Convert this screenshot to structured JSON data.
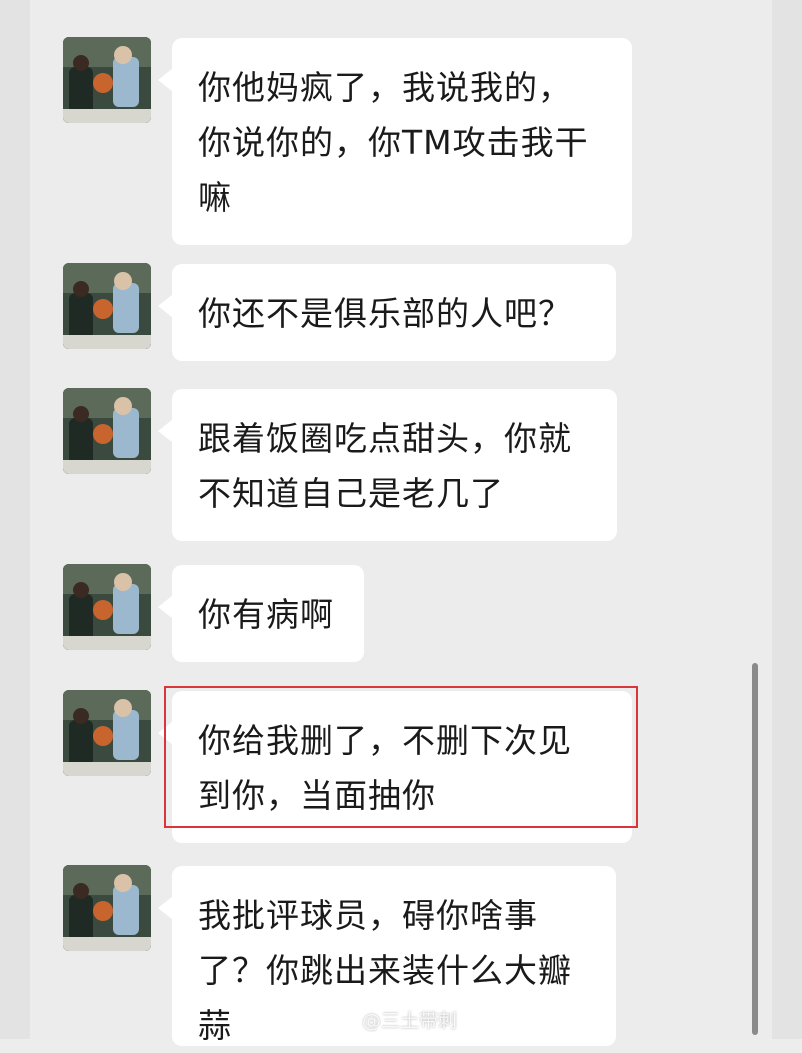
{
  "messages": [
    {
      "text": "你他妈疯了，我说我的，\n你说你的，你TM攻击我干\n嘛"
    },
    {
      "text": "你还不是俱乐部的人吧？"
    },
    {
      "text": "跟着饭圈吃点甜头，你就\n不知道自己是老几了"
    },
    {
      "text": "你有病啊"
    },
    {
      "text": "你给我删了，不删下次见\n到你，当面抽你"
    },
    {
      "text": "我批评球员，碍你啥事\n了？你跳出来装什么大瓣\n蒜"
    }
  ],
  "watermark": {
    "text": "@三土带刺",
    "icon": "weibo-icon"
  },
  "colors": {
    "background": "#ededed",
    "bubble": "#ffffff",
    "highlight": "#d9353b"
  }
}
